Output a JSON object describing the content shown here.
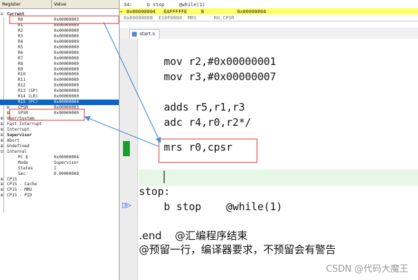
{
  "registers": {
    "header": {
      "name_col": "Register",
      "value_col": "Value"
    },
    "rows": [
      {
        "tog": "⊟",
        "name": "Current",
        "value": "",
        "indent": 0,
        "bold": true
      },
      {
        "tog": "",
        "name": "R0",
        "value": "0x00000003",
        "indent": 1
      },
      {
        "tog": "",
        "name": "R1",
        "value": "0x00000000",
        "indent": 1
      },
      {
        "tog": "",
        "name": "R2",
        "value": "0x00000000",
        "indent": 1
      },
      {
        "tog": "",
        "name": "R3",
        "value": "0x00000000",
        "indent": 1
      },
      {
        "tog": "",
        "name": "R4",
        "value": "0x00000000",
        "indent": 1
      },
      {
        "tog": "",
        "name": "R5",
        "value": "0x00000000",
        "indent": 1
      },
      {
        "tog": "",
        "name": "R6",
        "value": "0x00000000",
        "indent": 1
      },
      {
        "tog": "",
        "name": "R7",
        "value": "0x00000000",
        "indent": 1
      },
      {
        "tog": "",
        "name": "R8",
        "value": "0x00000000",
        "indent": 1
      },
      {
        "tog": "",
        "name": "R9",
        "value": "0x00000000",
        "indent": 1
      },
      {
        "tog": "",
        "name": "R10",
        "value": "0x00000000",
        "indent": 1
      },
      {
        "tog": "",
        "name": "R11",
        "value": "0x00000000",
        "indent": 1
      },
      {
        "tog": "",
        "name": "R12",
        "value": "0x00000000",
        "indent": 1
      },
      {
        "tog": "",
        "name": "R13 (SP)",
        "value": "0x00000000",
        "indent": 1
      },
      {
        "tog": "",
        "name": "R14 (LR)",
        "value": "0x00000000",
        "indent": 1
      },
      {
        "tog": "",
        "name": "R15 (PC)",
        "value": "0x00000004",
        "indent": 1,
        "selected": true
      },
      {
        "tog": "⊞",
        "name": "CPSR",
        "value": "0x00000003",
        "indent": 1
      },
      {
        "tog": "⊞",
        "name": "SPSR",
        "value": "0x00000000",
        "indent": 1
      },
      {
        "tog": "⊞",
        "name": "User/System",
        "value": "",
        "indent": 0
      },
      {
        "tog": "⊞",
        "name": "Fast Interrupt",
        "value": "",
        "indent": 0
      },
      {
        "tog": "⊞",
        "name": "Interrupt",
        "value": "",
        "indent": 0
      },
      {
        "tog": "⊞",
        "name": "Supervisor",
        "value": "",
        "indent": 0,
        "bold": true
      },
      {
        "tog": "⊞",
        "name": "Abort",
        "value": "",
        "indent": 0
      },
      {
        "tog": "⊞",
        "name": "Undefined",
        "value": "",
        "indent": 0
      },
      {
        "tog": "⊟",
        "name": "Internal",
        "value": "",
        "indent": 0
      },
      {
        "tog": "",
        "name": "PC  $",
        "value": "0x00000004",
        "indent": 2
      },
      {
        "tog": "",
        "name": "Mode",
        "value": "Supervisor",
        "indent": 2
      },
      {
        "tog": "",
        "name": "States",
        "value": "1",
        "indent": 2
      },
      {
        "tog": "",
        "name": "Sec",
        "value": "0.00000008",
        "indent": 2
      },
      {
        "tog": "⊞",
        "name": "CP15",
        "value": "",
        "indent": 0
      },
      {
        "tog": "⊞",
        "name": "CP15 - Cache",
        "value": "",
        "indent": 0
      },
      {
        "tog": "⊞",
        "name": "CP15 - MMU",
        "value": "",
        "indent": 0
      },
      {
        "tog": "⊞",
        "name": "CP15 - PID",
        "value": "",
        "indent": 0
      }
    ]
  },
  "disassembly": {
    "line1": "34:     b stop     @while(1)",
    "current": {
      "addr": "0x00000004",
      "opcode": "EAFFFFFE",
      "mnemonic": "B",
      "target": "0x00000004"
    },
    "line3": "0x00000008  E10F0000  MRS      R0,CPSR"
  },
  "editor": {
    "tab_label": "start.s",
    "lines": [
      {
        "text": "    mov r2,#0x00000001"
      },
      {
        "text": "    mov r3,#0x00000007"
      },
      {
        "text": ""
      },
      {
        "text": "    adds r5,r1,r3"
      },
      {
        "text": "    adc r4,r0,r2*/"
      },
      {
        "text": ""
      },
      {
        "text": "    mrs r0,cpsr"
      },
      {
        "text": ""
      },
      {
        "text": ""
      },
      {
        "text": "stop:"
      },
      {
        "text": "    b stop    @while(1)"
      },
      {
        "text": ""
      },
      {
        "text": ".end    @汇编程序结束"
      },
      {
        "text": "@预留一行，编译器要求，不预留会有警告"
      }
    ]
  },
  "watermark": "CSDN @代码大魔王",
  "colors": {
    "selection": "#0a64c8",
    "annotation_red": "#e03030",
    "annotation_blue": "#4a90d0",
    "current_line": "#ffff66",
    "breakpoint": "#1f9a2c"
  }
}
